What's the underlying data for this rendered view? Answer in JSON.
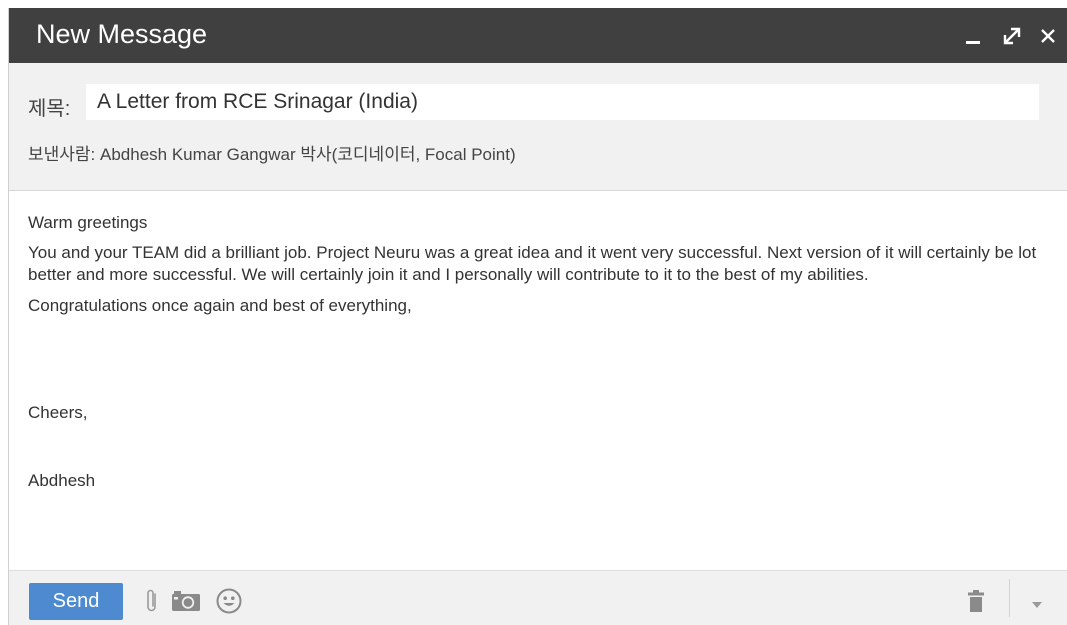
{
  "window": {
    "title": "New Message",
    "controls": {
      "minimize_icon": "minimize-icon",
      "maximize_icon": "expand-icon",
      "close_icon": "close-icon"
    }
  },
  "header": {
    "subject_label": "제목:",
    "subject_value": "A Letter from RCE Srinagar (India)",
    "sender": "보낸사람: Abdhesh Kumar Gangwar 박사(코디네이터, Focal Point)"
  },
  "body": {
    "greeting": "Warm greetings",
    "paragraph": "You and your TEAM did a brilliant job. Project Neuru was a great idea and it went very successful. Next version of it will certainly be lot better and more successful. We will certainly join it and I personally will contribute to it to the best of my abilities.",
    "congrats": "Congratulations once again and best of everything,",
    "closing": "Cheers,",
    "signature": "Abdhesh"
  },
  "toolbar": {
    "send_label": "Send",
    "icons": [
      "paperclip-icon",
      "camera-icon",
      "emoji-icon",
      "trash-icon",
      "dropdown-arrow-icon"
    ]
  },
  "colors": {
    "titlebar": "#404040",
    "header_bg": "#f1f1f1",
    "send_button": "#4d8ad0"
  }
}
